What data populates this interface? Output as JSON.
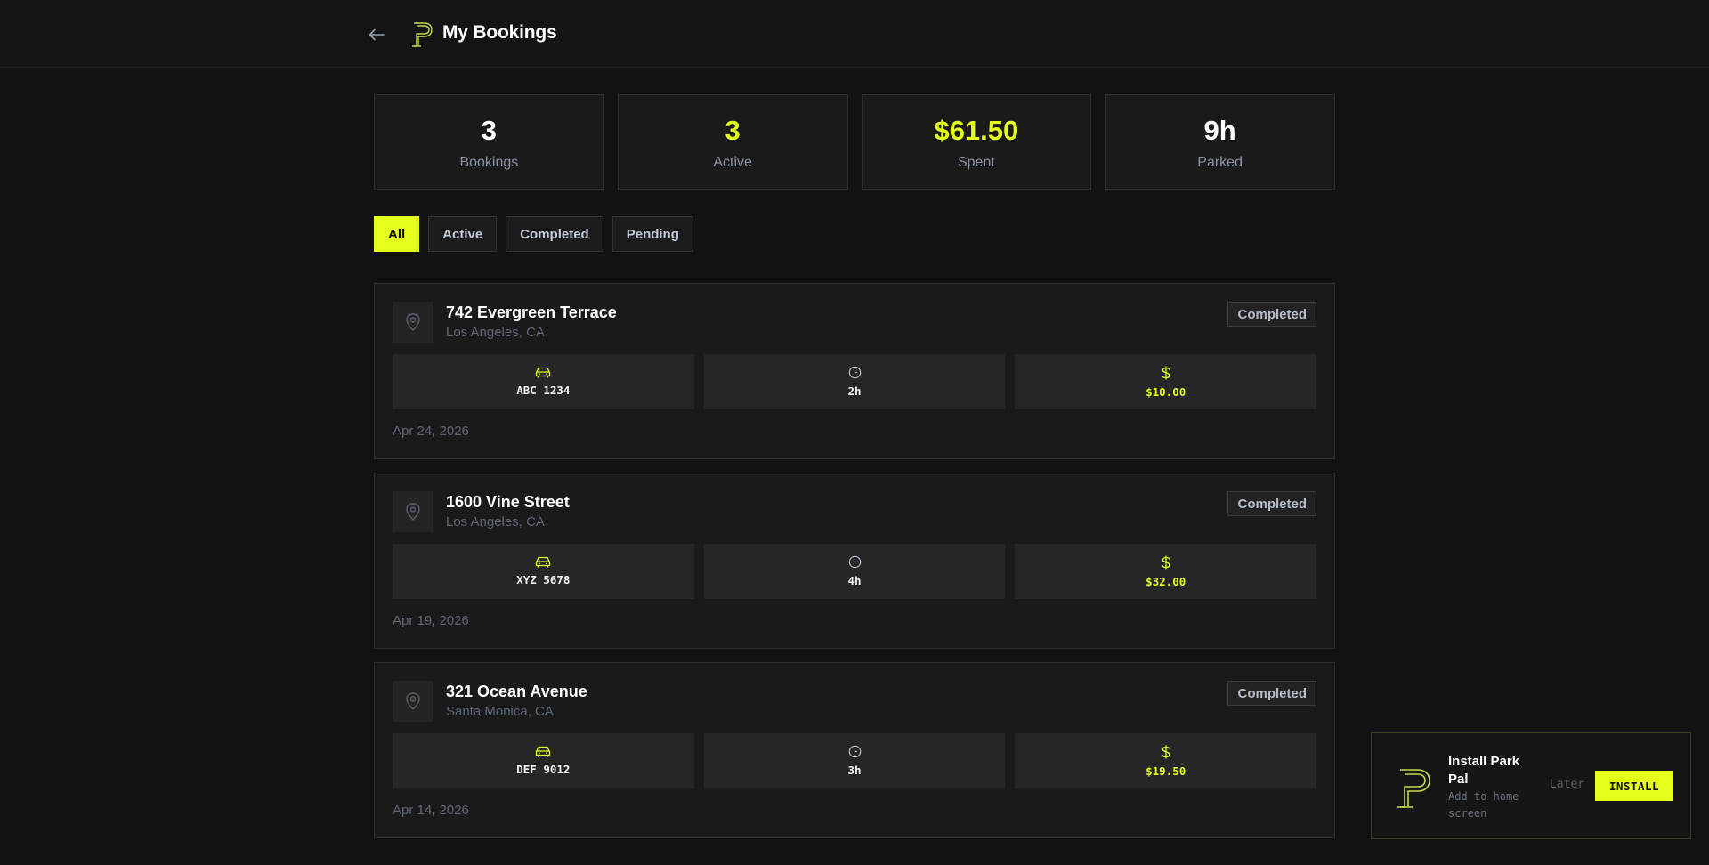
{
  "header": {
    "title": "My Bookings",
    "back_icon": "arrow-left-icon",
    "logo_icon": "park-pal-logo-icon"
  },
  "stats": [
    {
      "value": "3",
      "label": "Bookings"
    },
    {
      "value": "3",
      "label": "Active"
    },
    {
      "value": "$61.50",
      "label": "Spent"
    },
    {
      "value": "9h",
      "label": "Parked"
    }
  ],
  "filters": [
    {
      "label": "All",
      "selected": true
    },
    {
      "label": "Active",
      "selected": false
    },
    {
      "label": "Completed",
      "selected": false
    },
    {
      "label": "Pending",
      "selected": false
    }
  ],
  "bookings": [
    {
      "address": "742 Evergreen Terrace",
      "city": "Los Angeles, CA",
      "status": "Completed",
      "plate": "ABC 1234",
      "duration": "2h",
      "price": "$10.00",
      "date": "Apr 24, 2026"
    },
    {
      "address": "1600 Vine Street",
      "city": "Los Angeles, CA",
      "status": "Completed",
      "plate": "XYZ 5678",
      "duration": "4h",
      "price": "$32.00",
      "date": "Apr 19, 2026"
    },
    {
      "address": "321 Ocean Avenue",
      "city": "Santa Monica, CA",
      "status": "Completed",
      "plate": "DEF 9012",
      "duration": "3h",
      "price": "$19.50",
      "date": "Apr 14, 2026"
    }
  ],
  "install_prompt": {
    "title": "Install Park Pal",
    "subtitle": "Add to home screen",
    "later_label": "Later",
    "install_label": "INSTALL"
  },
  "colors": {
    "accent": "#e4ff1a",
    "background": "#121212",
    "card": "#1a1a1a"
  }
}
